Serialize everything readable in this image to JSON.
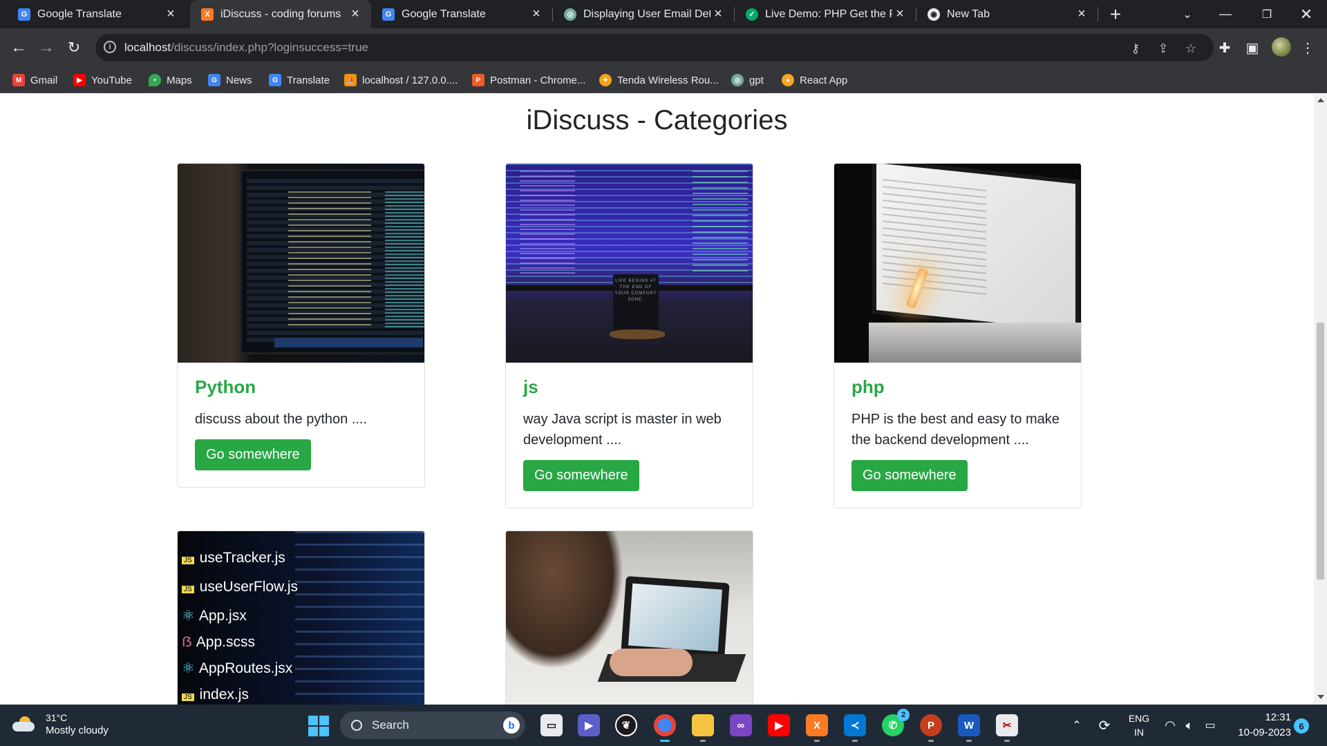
{
  "browser": {
    "tabs": [
      {
        "title": "Google Translate",
        "favicon": "google-translate-icon",
        "active": false
      },
      {
        "title": "iDiscuss - coding forums",
        "favicon": "xampp-icon",
        "active": true
      },
      {
        "title": "Google Translate",
        "favicon": "google-translate-icon",
        "active": false
      },
      {
        "title": "Displaying User Email Detai",
        "favicon": "chatgpt-icon",
        "active": false
      },
      {
        "title": "Live Demo: PHP Get the Pa",
        "favicon": "shield-icon",
        "active": false
      },
      {
        "title": "New Tab",
        "favicon": "chrome-icon",
        "active": false
      }
    ],
    "url_host": "localhost",
    "url_path": "/discuss/index.php?loginsuccess=true",
    "bookmarks": [
      {
        "label": "Gmail",
        "icon": "gmail-icon",
        "color": "#ea4335"
      },
      {
        "label": "YouTube",
        "icon": "youtube-icon",
        "color": "#ff0000"
      },
      {
        "label": "Maps",
        "icon": "maps-icon",
        "color": "#34a853"
      },
      {
        "label": "News",
        "icon": "news-icon",
        "color": "#4285f4"
      },
      {
        "label": "Translate",
        "icon": "translate-icon",
        "color": "#4285f4"
      },
      {
        "label": "localhost / 127.0.0....",
        "icon": "phpmyadmin-icon",
        "color": "#f29111"
      },
      {
        "label": "Postman - Chrome...",
        "icon": "postman-icon",
        "color": "#ef5b25"
      },
      {
        "label": "Tenda Wireless Rou...",
        "icon": "tenda-icon",
        "color": "#f7a21b"
      },
      {
        "label": "gpt",
        "icon": "chatgpt-icon",
        "color": "#74aa9c"
      },
      {
        "label": "React App",
        "icon": "react-app-icon",
        "color": "#f6a623"
      }
    ]
  },
  "page": {
    "title": "iDiscuss - Categories",
    "cards": [
      {
        "title": "Python",
        "text": "discuss about the python ....",
        "button": "Go somewhere"
      },
      {
        "title": "js",
        "text": "way Java script is master in web development ....",
        "button": "Go somewhere"
      },
      {
        "title": "php",
        "text": "PHP is the best and easy to make the backend development ....",
        "button": "Go somewhere"
      },
      {
        "title": "",
        "text": "",
        "button": ""
      },
      {
        "title": "",
        "text": "",
        "button": ""
      }
    ],
    "card4_image_files": [
      "useTracker.js",
      "useUserFlow.js",
      "App.jsx",
      "App.scss",
      "AppRoutes.jsx",
      "index.js"
    ],
    "mug_text": "LIFE BEGINS AT THE END OF YOUR COMFORT ZONE."
  },
  "taskbar": {
    "weather_temp": "31°C",
    "weather_desc": "Mostly cloudy",
    "search_placeholder": "Search",
    "lang_top": "ENG",
    "lang_bottom": "IN",
    "time": "12:31",
    "date": "10-09-2023",
    "notification_count": "6",
    "whatsapp_badge": "2"
  },
  "colors": {
    "accent_green": "#28a745",
    "chrome_dark": "#202124",
    "chrome_toolbar": "#35363a"
  }
}
